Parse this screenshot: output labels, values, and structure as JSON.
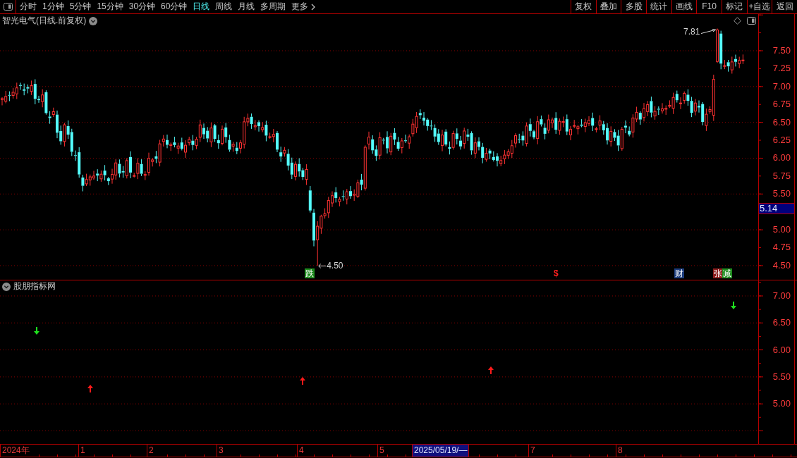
{
  "toolbar": {
    "tabs": [
      {
        "label": "分时",
        "selected": false
      },
      {
        "label": "1分钟",
        "selected": false
      },
      {
        "label": "5分钟",
        "selected": false
      },
      {
        "label": "15分钟",
        "selected": false
      },
      {
        "label": "30分钟",
        "selected": false
      },
      {
        "label": "60分钟",
        "selected": false
      },
      {
        "label": "日线",
        "selected": true
      },
      {
        "label": "周线",
        "selected": false
      },
      {
        "label": "月线",
        "selected": false
      },
      {
        "label": "多周期",
        "selected": false
      }
    ],
    "more": "更多",
    "buttons": [
      "复权",
      "叠加",
      "多股",
      "统计",
      "画线",
      "F10",
      "标记",
      "+自选",
      "返回"
    ]
  },
  "price_chart": {
    "title": "智光电气(日线.前复权)",
    "axis_labels": [
      "7.50",
      "7.25",
      "7.00",
      "6.75",
      "6.50",
      "6.25",
      "6.00",
      "5.75",
      "5.50",
      "5.00",
      "4.75",
      "4.50"
    ],
    "cursor_price": "5.14",
    "high_label": "7.81",
    "low_label": "4.50",
    "markers": [
      {
        "kind": "tag",
        "label": "跌",
        "color": "#1e8c1e"
      },
      {
        "kind": "symbol",
        "label": "$",
        "color": "#ff2020"
      },
      {
        "kind": "tag",
        "label": "财",
        "color": "#1c3c7c"
      },
      {
        "kind": "tag",
        "label": "张",
        "color": "#8c1c1c"
      },
      {
        "kind": "tag",
        "label": "减",
        "color": "#1e8c1e"
      }
    ]
  },
  "indicator_panel": {
    "title": "股朋指标网",
    "axis_labels": [
      "7.00",
      "6.50",
      "6.00",
      "5.50",
      "5.00"
    ],
    "signals": [
      {
        "kind": "down"
      },
      {
        "kind": "up"
      },
      {
        "kind": "up"
      },
      {
        "kind": "up"
      },
      {
        "kind": "down"
      }
    ]
  },
  "date_axis": {
    "labels": [
      "2024年",
      "1",
      "2",
      "3",
      "4",
      "5",
      "7",
      "8"
    ],
    "cursor_date": "2025/05/19/—"
  }
}
